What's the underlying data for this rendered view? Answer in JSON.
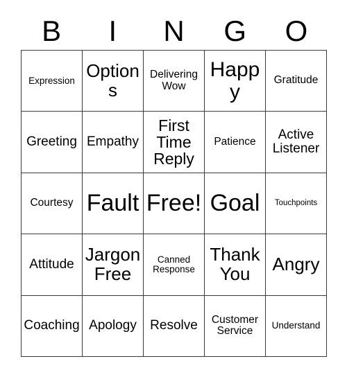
{
  "card": {
    "title": "BINGO",
    "header_letters": [
      "B",
      "I",
      "N",
      "G",
      "O"
    ],
    "columns": 5,
    "rows": 5,
    "border_color": "#3a3a3a",
    "background_color": "#ffffff",
    "text_color": "#000000",
    "free_space": "Free!",
    "cells": [
      {
        "text": "Expression",
        "size": "fs-sm",
        "row": 1,
        "col": 1
      },
      {
        "text": "Options",
        "size": "fs-2xl",
        "row": 1,
        "col": 2
      },
      {
        "text": "Delivering\nWow",
        "size": "fs-md",
        "row": 1,
        "col": 3
      },
      {
        "text": "Happy",
        "size": "fs-3xl",
        "row": 1,
        "col": 4
      },
      {
        "text": "Gratitude",
        "size": "fs-md",
        "row": 1,
        "col": 5
      },
      {
        "text": "Greeting",
        "size": "fs-lg",
        "row": 2,
        "col": 1
      },
      {
        "text": "Empathy",
        "size": "fs-lg",
        "row": 2,
        "col": 2
      },
      {
        "text": "First\nTime\nReply",
        "size": "fs-xl",
        "row": 2,
        "col": 3
      },
      {
        "text": "Patience",
        "size": "fs-md",
        "row": 2,
        "col": 4
      },
      {
        "text": "Active\nListener",
        "size": "fs-lg",
        "row": 2,
        "col": 5
      },
      {
        "text": "Courtesy",
        "size": "fs-md",
        "row": 3,
        "col": 1
      },
      {
        "text": "Fault",
        "size": "fs-4xl",
        "row": 3,
        "col": 2
      },
      {
        "text": "Free!",
        "size": "fs-4xl",
        "row": 3,
        "col": 3
      },
      {
        "text": "Goal",
        "size": "fs-4xl",
        "row": 3,
        "col": 4
      },
      {
        "text": "Touchpoints",
        "size": "fs-xs",
        "row": 3,
        "col": 5
      },
      {
        "text": "Attitude",
        "size": "fs-lg",
        "row": 4,
        "col": 1
      },
      {
        "text": "Jargon\nFree",
        "size": "fs-2xl",
        "row": 4,
        "col": 2
      },
      {
        "text": "Canned\nResponse",
        "size": "fs-sm",
        "row": 4,
        "col": 3
      },
      {
        "text": "Thank\nYou",
        "size": "fs-2xl",
        "row": 4,
        "col": 4
      },
      {
        "text": "Angry",
        "size": "fs-2xl",
        "row": 4,
        "col": 5
      },
      {
        "text": "Coaching",
        "size": "fs-lg",
        "row": 5,
        "col": 1
      },
      {
        "text": "Apology",
        "size": "fs-lg",
        "row": 5,
        "col": 2
      },
      {
        "text": "Resolve",
        "size": "fs-lg",
        "row": 5,
        "col": 3
      },
      {
        "text": "Customer\nService",
        "size": "fs-md",
        "row": 5,
        "col": 4
      },
      {
        "text": "Understand",
        "size": "fs-sm",
        "row": 5,
        "col": 5
      }
    ]
  }
}
